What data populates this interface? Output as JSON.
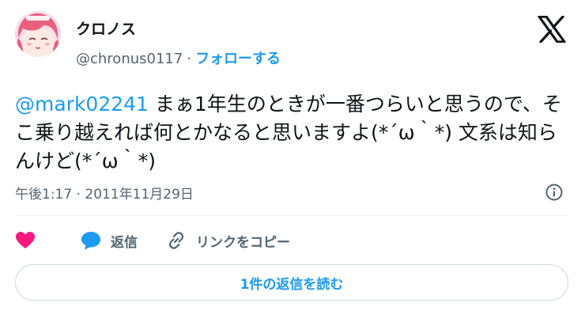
{
  "author": {
    "display_name": "クロノス",
    "handle": "@chronus0117",
    "separator": "·",
    "follow_label": "フォローする",
    "avatar": "anime-girl-pink-hair-avatar"
  },
  "brand": {
    "logo": "x-logo-icon"
  },
  "tweet": {
    "mention": "@mark02241",
    "text": " まぁ1年生のときが一番つらいと思うので、そこ乗り越えれば何とかなると思いますよ(*´ω｀*) 文系は知らんけど(*´ω｀*)"
  },
  "meta": {
    "timestamp": "午後1:17 · 2011年11月29日",
    "info_icon": "info-icon"
  },
  "actions": {
    "like_icon": "heart-icon",
    "reply_icon": "reply-bubble-icon",
    "reply_label": "返信",
    "copy_icon": "link-icon",
    "copy_label": "リンクをコピー"
  },
  "footer": {
    "read_replies_label": "1件の返信を読む"
  },
  "colors": {
    "accent": "#1d9bf0",
    "like": "#f91880",
    "muted": "#536471",
    "text": "#0f1419",
    "border": "#cfd9de"
  }
}
